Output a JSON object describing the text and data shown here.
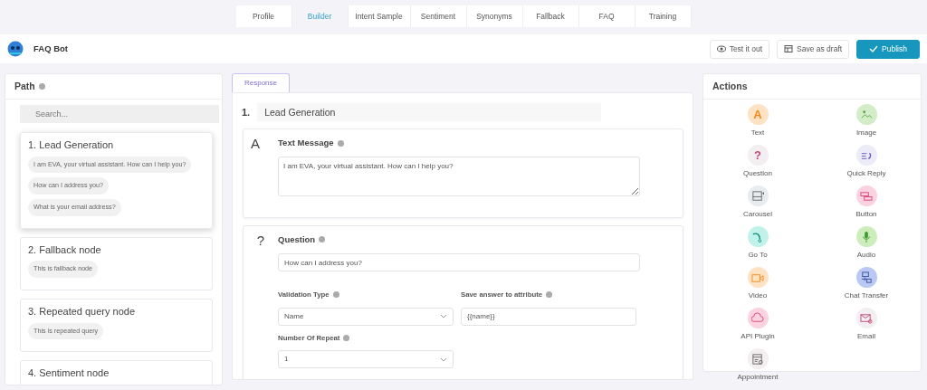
{
  "top_tabs": [
    {
      "label": "Profile",
      "selected": false
    },
    {
      "label": "Builder",
      "selected": true
    },
    {
      "label": "Intent Sample",
      "selected": false
    },
    {
      "label": "Sentiment",
      "selected": false
    },
    {
      "label": "Synonyms",
      "selected": false
    },
    {
      "label": "Fallback",
      "selected": false
    },
    {
      "label": "FAQ",
      "selected": false
    },
    {
      "label": "Training",
      "selected": false
    }
  ],
  "bot": {
    "name": "FAQ Bot"
  },
  "header_buttons": [
    {
      "kind": "test",
      "label": "Test it out"
    },
    {
      "kind": "draft",
      "label": "Save as draft"
    },
    {
      "kind": "publish",
      "label": "Publish"
    }
  ],
  "path": {
    "title": "Path",
    "search": {
      "placeholder": "Search..."
    },
    "nodes": [
      {
        "title": "1. Lead Generation",
        "selected": true,
        "messages": [
          "I am EVA, your virtual assistant. How can I help you?",
          "How can I address you?",
          "What is your email address?"
        ]
      },
      {
        "title": "2. Fallback node",
        "selected": false,
        "messages": [
          "This is fallback node"
        ]
      },
      {
        "title": "3. Repeated query node",
        "selected": false,
        "messages": [
          "This is repeated query"
        ]
      },
      {
        "title": "4. Sentiment node",
        "selected": false
      }
    ]
  },
  "editor": {
    "tab": "Response",
    "step_number": "1.",
    "step_name": "Lead Generation",
    "text_message": {
      "icon": "A",
      "title": "Text Message",
      "value": "I am EVA, your virtual assistant. How can I help you?"
    },
    "question": {
      "icon": "?",
      "title": "Question",
      "value": "How can I address you?",
      "validation_label": "Validation Type",
      "validation_value": "Name",
      "attribute_label": "Save answer to attribute",
      "attribute_value": "{{name}}",
      "repeat_label": "Number Of Repeat",
      "repeat_value": "1"
    }
  },
  "actions": {
    "title": "Actions",
    "items": [
      {
        "kind": "text",
        "glyph": "A",
        "label": "Text",
        "color": "#fde3c4"
      },
      {
        "kind": "image",
        "label": "Image",
        "color": "#d3edc9"
      },
      {
        "kind": "question",
        "glyph": "?",
        "label": "Question",
        "color": "#f3eef0"
      },
      {
        "kind": "quick_reply",
        "label": "Quick Reply",
        "color": "#ecebf8"
      },
      {
        "kind": "carousel",
        "label": "Carousel",
        "color": "#e9ecef"
      },
      {
        "kind": "button",
        "label": "Button",
        "color": "#fbd3e0"
      },
      {
        "kind": "goto",
        "label": "Go To",
        "color": "#c0f2ea"
      },
      {
        "kind": "audio",
        "label": "Audio",
        "color": "#cdedbd"
      },
      {
        "kind": "video",
        "label": "Video",
        "color": "#fde3c4"
      },
      {
        "kind": "chat_transfer",
        "label": "Chat Transfer",
        "color": "#b9c9f3"
      },
      {
        "kind": "api",
        "label": "API Plugin",
        "color": "#fbd3e0"
      },
      {
        "kind": "email",
        "label": "Email",
        "color": "#f3eef0"
      },
      {
        "kind": "appointment",
        "label": "Appointment",
        "color": "#f3eef0"
      }
    ]
  }
}
